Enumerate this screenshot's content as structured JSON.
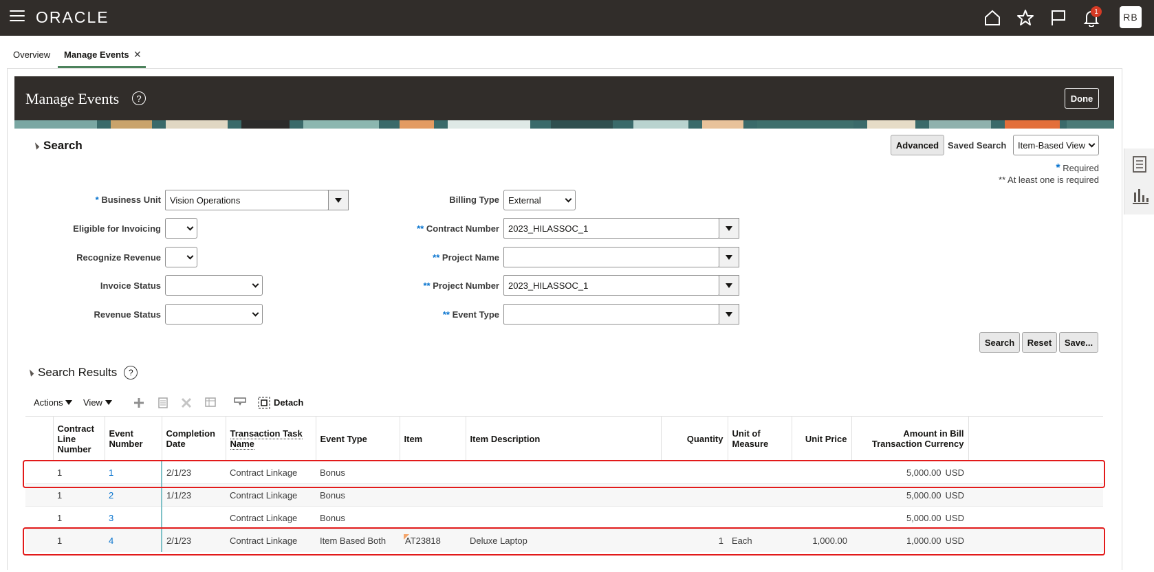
{
  "topbar": {
    "logo": "ORACLE",
    "notification_count": "1",
    "avatar_initials": "RB"
  },
  "tabs": [
    {
      "label": "Overview"
    },
    {
      "label": "Manage Events"
    }
  ],
  "page": {
    "title": "Manage Events",
    "help": "?",
    "done_label": "Done"
  },
  "search": {
    "title": "Search",
    "advanced_label": "Advanced",
    "saved_search_label": "Saved Search",
    "saved_search_value": "Item-Based View",
    "required_marker": "*",
    "required_note": "Required",
    "at_least_one_note": "** At least one is required",
    "fields": {
      "business_unit": {
        "label": "Business Unit",
        "marker": "*",
        "value": "Vision Operations"
      },
      "eligible_for_invoicing": {
        "label": "Eligible for Invoicing",
        "value": ""
      },
      "recognize_revenue": {
        "label": "Recognize Revenue",
        "value": ""
      },
      "invoice_status": {
        "label": "Invoice Status",
        "value": ""
      },
      "revenue_status": {
        "label": "Revenue Status",
        "value": ""
      },
      "billing_type": {
        "label": "Billing Type",
        "value": "External"
      },
      "contract_number": {
        "label": "Contract Number",
        "marker": "**",
        "value": "2023_HILASSOC_1"
      },
      "project_name": {
        "label": "Project Name",
        "marker": "**",
        "value": ""
      },
      "project_number": {
        "label": "Project Number",
        "marker": "**",
        "value": "2023_HILASSOC_1"
      },
      "event_type": {
        "label": "Event Type",
        "marker": "**",
        "value": ""
      }
    },
    "search_btn": "Search",
    "reset_btn": "Reset",
    "save_btn": "Save..."
  },
  "results": {
    "title": "Search Results",
    "help": "?",
    "actions_label": "Actions",
    "view_label": "View",
    "detach_label": "Detach",
    "columns": {
      "contract_line": "Contract Line Number",
      "event_number": "Event Number",
      "completion_date": "Completion Date",
      "task_name": "Transaction Task Name",
      "event_type": "Event Type",
      "item": "Item",
      "item_description": "Item Description",
      "quantity": "Quantity",
      "uom": "Unit of Measure",
      "unit_price": "Unit Price",
      "amount": "Amount in Bill Transaction Currency"
    },
    "rows": [
      {
        "contract_line": "1",
        "event_number": "1",
        "completion_date": "2/1/23",
        "task_name": "Contract Linkage",
        "event_type": "Bonus",
        "item": "",
        "item_description": "",
        "quantity": "",
        "uom": "",
        "unit_price": "",
        "amount": "5,000.00",
        "currency": "USD"
      },
      {
        "contract_line": "1",
        "event_number": "2",
        "completion_date": "1/1/23",
        "task_name": "Contract Linkage",
        "event_type": "Bonus",
        "item": "",
        "item_description": "",
        "quantity": "",
        "uom": "",
        "unit_price": "",
        "amount": "5,000.00",
        "currency": "USD"
      },
      {
        "contract_line": "1",
        "event_number": "3",
        "completion_date": "",
        "task_name": "Contract Linkage",
        "event_type": "Bonus",
        "item": "",
        "item_description": "",
        "quantity": "",
        "uom": "",
        "unit_price": "",
        "amount": "5,000.00",
        "currency": "USD"
      },
      {
        "contract_line": "1",
        "event_number": "4",
        "completion_date": "2/1/23",
        "task_name": "Contract Linkage",
        "event_type": "Item Based Both",
        "item": "AT23818",
        "item_description": "Deluxe Laptop",
        "quantity": "1",
        "uom": "Each",
        "unit_price": "1,000.00",
        "amount": "1,000.00",
        "currency": "USD"
      }
    ]
  },
  "colors": {
    "topbar": "#312d2a",
    "link": "#0572ce",
    "tab_underline": "#4c825c",
    "highlight_box": "#e21a1a"
  }
}
